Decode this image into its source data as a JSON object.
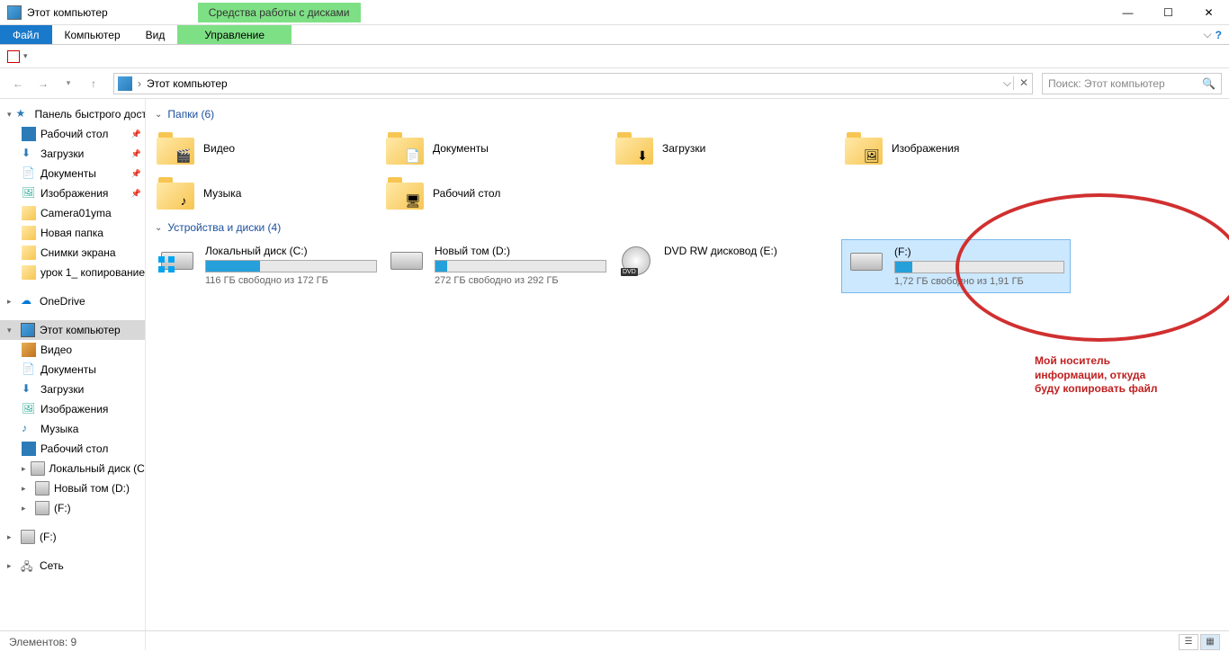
{
  "window": {
    "title": "Этот компьютер",
    "ribbon_tab": "Средства работы с дисками"
  },
  "menu": {
    "file": "Файл",
    "computer": "Компьютер",
    "view": "Вид",
    "manage": "Управление"
  },
  "nav": {
    "addr_root": "Этот компьютер",
    "search_placeholder": "Поиск: Этот компьютер"
  },
  "sidebar": {
    "quick": "Панель быстрого доступа",
    "quick_items": [
      "Рабочий стол",
      "Загрузки",
      "Документы",
      "Изображения",
      "Camera01yma",
      "Новая папка",
      "Снимки экрана",
      "урок 1_ копирование"
    ],
    "onedrive": "OneDrive",
    "thispc": "Этот компьютер",
    "pc_items": [
      "Видео",
      "Документы",
      "Загрузки",
      "Изображения",
      "Музыка",
      "Рабочий стол",
      "Локальный диск (C:)",
      "Новый том (D:)",
      "(F:)"
    ],
    "f2": "(F:)",
    "network": "Сеть"
  },
  "groups": {
    "folders": "Папки (6)",
    "drives": "Устройства и диски (4)"
  },
  "folders": [
    {
      "name": "Видео",
      "overlay": "🎬"
    },
    {
      "name": "Документы",
      "overlay": "📄"
    },
    {
      "name": "Загрузки",
      "overlay": "⬇"
    },
    {
      "name": "Изображения",
      "overlay": "🖼"
    },
    {
      "name": "Музыка",
      "overlay": "♪"
    },
    {
      "name": "Рабочий стол",
      "overlay": "🖥"
    }
  ],
  "drives": [
    {
      "name": "Локальный диск (C:)",
      "free": "116 ГБ свободно из 172 ГБ",
      "pct": 32,
      "win": true
    },
    {
      "name": "Новый том (D:)",
      "free": "272 ГБ свободно из 292 ГБ",
      "pct": 7
    },
    {
      "name": "DVD RW дисковод (E:)",
      "dvd": true
    },
    {
      "name": "(F:)",
      "free": "1,72 ГБ свободно из 1,91 ГБ",
      "pct": 10,
      "selected": true
    }
  ],
  "annot": {
    "l1": "Мой носитель",
    "l2": "информации, откуда",
    "l3": "буду копировать файл"
  },
  "status": {
    "count": "Элементов: 9"
  }
}
